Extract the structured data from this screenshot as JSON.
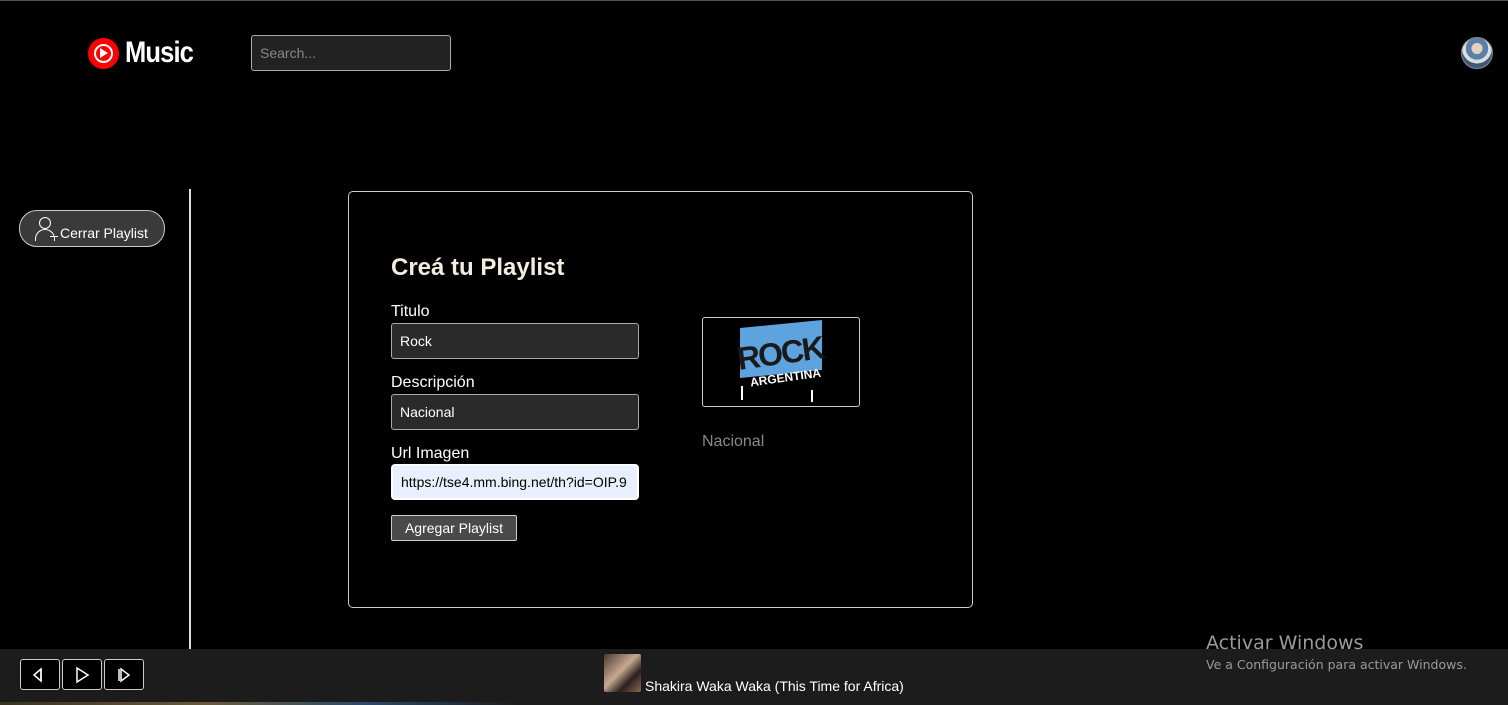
{
  "header": {
    "logo_text": "Music",
    "search_placeholder": "Search..."
  },
  "sidebar": {
    "close_playlist_label": "Cerrar Playlist"
  },
  "form": {
    "title": "Creá tu Playlist",
    "fields": [
      {
        "label": "Titulo",
        "value": "Rock"
      },
      {
        "label": "Descripción",
        "value": "Nacional"
      },
      {
        "label": "Url Imagen",
        "value": "https://tse4.mm.bing.net/th?id=OIP.9"
      }
    ],
    "submit_label": "Agregar Playlist"
  },
  "preview": {
    "image_text_top": "ROCK",
    "image_text_bottom": "ARGENTINA",
    "description": "Nacional"
  },
  "player": {
    "now_playing": "Shakira Waka Waka (This Time for Africa)"
  },
  "watermark": {
    "title": "Activar Windows",
    "subtitle": "Ve a Configuración para activar Windows."
  },
  "colors": {
    "background": "#000000",
    "brand_red": "#ff0000",
    "player_bar": "#1c1c1c",
    "title_text": "#f3ede0"
  }
}
